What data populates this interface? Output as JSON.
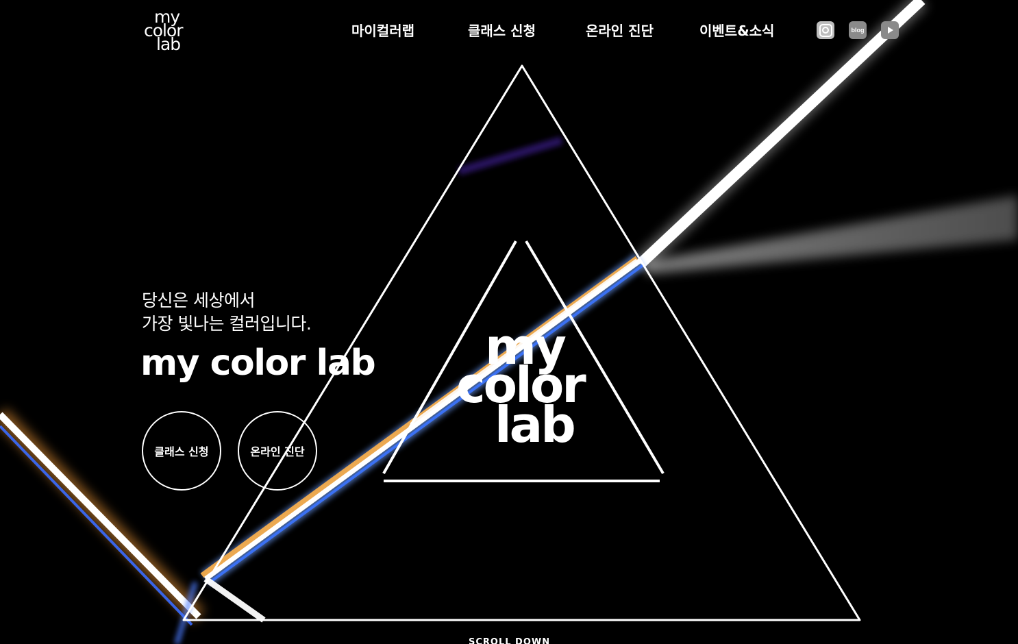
{
  "header": {
    "logo": {
      "line1": "my",
      "line2": "color",
      "line3": "lab"
    },
    "nav": [
      {
        "label": "마이컬러랩"
      },
      {
        "label": "클래스 신청"
      },
      {
        "label": "온라인 진단"
      },
      {
        "label": "이벤트&소식"
      }
    ],
    "social": {
      "instagram": "instagram-icon",
      "blog": "blog",
      "youtube": "youtube-icon"
    }
  },
  "hero": {
    "tagline_line1": "당신은 세상에서",
    "tagline_line2": "가장 빛나는 컬러입니다.",
    "brand": "my color lab",
    "buttons": [
      {
        "label": "클래스 신청"
      },
      {
        "label": "온라인 진단"
      }
    ],
    "center_logo": {
      "line1": "my",
      "line2": "color",
      "line3": "lab"
    },
    "scroll_down": "SCROLL DOWN"
  },
  "colors": {
    "background": "#000000",
    "foreground": "#ffffff",
    "social_gray": "#8a8a8a"
  }
}
